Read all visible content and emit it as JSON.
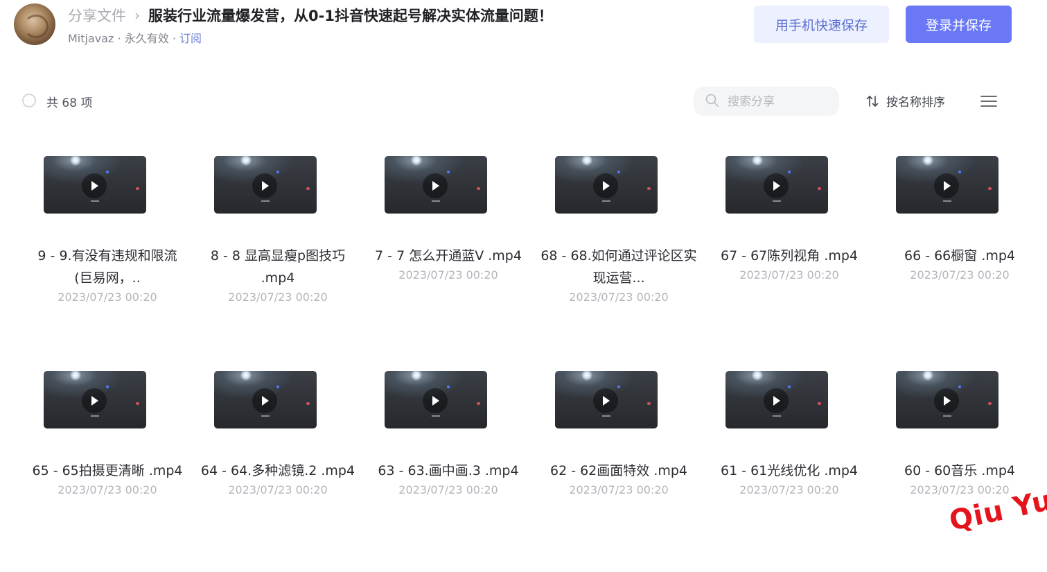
{
  "header": {
    "breadcrumb_root": "分享文件",
    "breadcrumb_sep": "›",
    "share_title": "服装行业流量爆发营，从0-1抖音快速起号解决实体流量问题！",
    "owner": "Mitjavaz",
    "validity": "永久有效",
    "dot": "·",
    "subscribe": "订阅",
    "save_phone_label": "用手机快速保存",
    "login_save_label": "登录并保存",
    "accent_color": "#6a78f5"
  },
  "toolbar": {
    "count_text": "共 68 项",
    "search_placeholder": "搜索分享",
    "sort_label": "按名称排序"
  },
  "files": [
    {
      "name": "9 - 9.有没有违规和限流(巨易网，..",
      "date": "2023/07/23 00:20"
    },
    {
      "name": "8 - 8 显高显瘦p图技巧 .mp4",
      "date": "2023/07/23 00:20"
    },
    {
      "name": "7 - 7 怎么开通蓝V .mp4",
      "date": "2023/07/23 00:20"
    },
    {
      "name": "68 - 68.如何通过评论区实现运营...",
      "date": "2023/07/23 00:20"
    },
    {
      "name": "67 - 67陈列视角 .mp4",
      "date": "2023/07/23 00:20"
    },
    {
      "name": "66 - 66橱窗 .mp4",
      "date": "2023/07/23 00:20"
    },
    {
      "name": "65 - 65拍摄更清晰 .mp4",
      "date": "2023/07/23 00:20"
    },
    {
      "name": "64 - 64.多种滤镜.2 .mp4",
      "date": "2023/07/23 00:20"
    },
    {
      "name": "63 - 63.画中画.3 .mp4",
      "date": "2023/07/23 00:20"
    },
    {
      "name": "62 - 62画面特效 .mp4",
      "date": "2023/07/23 00:20"
    },
    {
      "name": "61 - 61光线优化 .mp4",
      "date": "2023/07/23 00:20"
    },
    {
      "name": "60 - 60音乐 .mp4",
      "date": "2023/07/23 00:20"
    }
  ],
  "watermark": "Qiu  Yue"
}
